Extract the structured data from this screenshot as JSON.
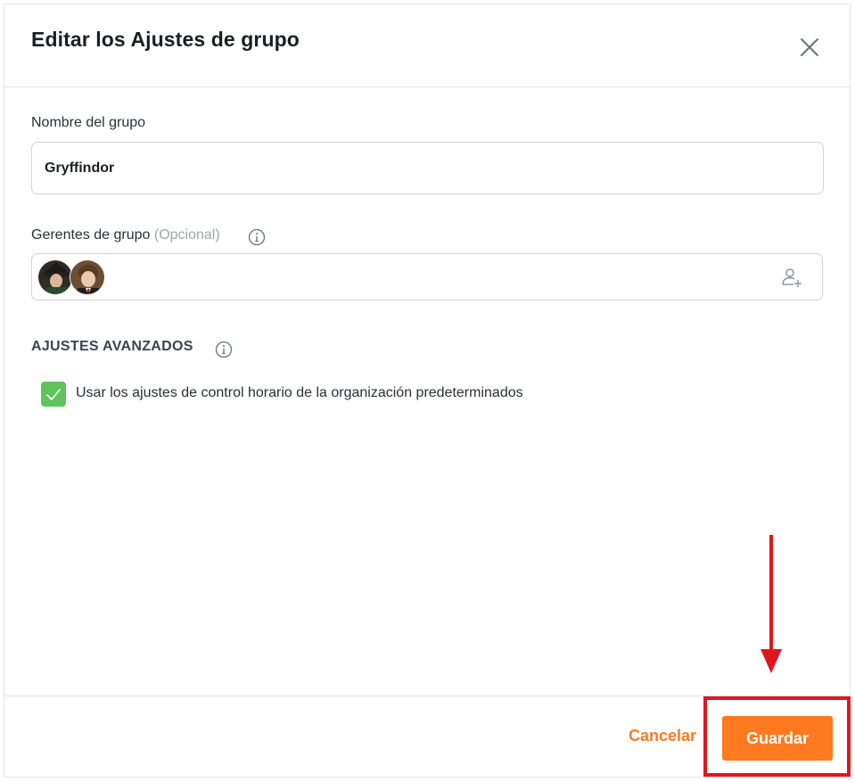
{
  "dialog": {
    "title": "Editar los Ajustes de grupo",
    "close_icon": "close-icon"
  },
  "group_name": {
    "label": "Nombre del grupo",
    "value": "Gryffindor"
  },
  "managers": {
    "label": "Gerentes de grupo",
    "optional_label": "(Opcional)",
    "info_icon": "info-icon",
    "avatars": [
      {
        "name": "avatar-1"
      },
      {
        "name": "avatar-2"
      }
    ],
    "add_icon": "add-user-icon"
  },
  "advanced": {
    "title": "AJUSTES AVANZADOS",
    "info_icon": "info-icon",
    "checkbox_label": "Usar los ajustes de control horario de la organización predeterminados",
    "checked": true
  },
  "footer": {
    "cancel_label": "Cancelar",
    "save_label": "Guardar"
  },
  "colors": {
    "accent": "#ff7a1f",
    "checkbox": "#5cc45b",
    "annotation": "#e0161e"
  }
}
